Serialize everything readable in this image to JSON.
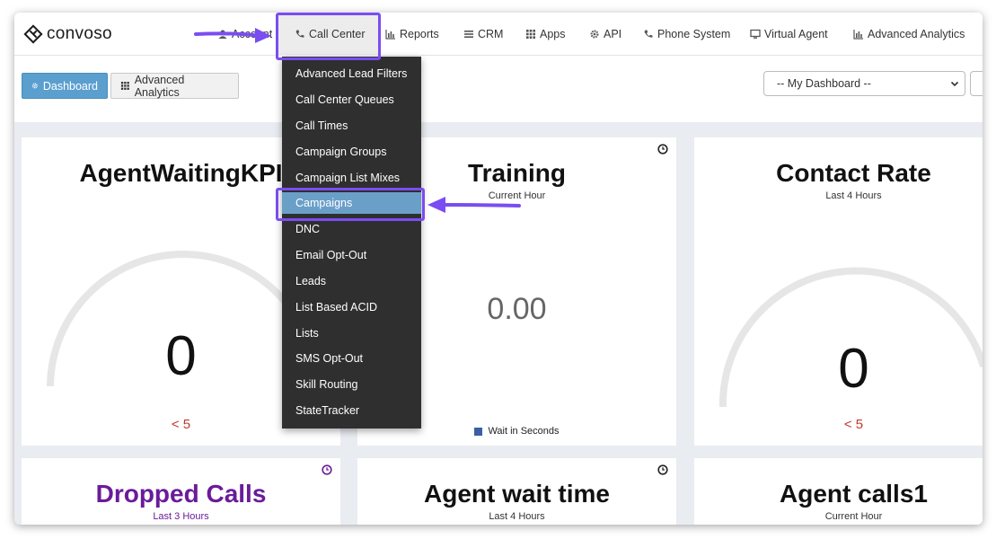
{
  "brand": {
    "logo_text": "convoso"
  },
  "nav": {
    "items": [
      {
        "label": "Account",
        "icon": "user-icon"
      },
      {
        "label": "Call Center",
        "icon": "phone-icon"
      },
      {
        "label": "Reports",
        "icon": "bar-chart-icon"
      },
      {
        "label": "CRM",
        "icon": "list-icon"
      },
      {
        "label": "Apps",
        "icon": "grid-icon"
      },
      {
        "label": "API",
        "icon": "gear-icon"
      },
      {
        "label": "Phone System",
        "icon": "phone-icon"
      },
      {
        "label": "Virtual Agent",
        "icon": "monitor-icon"
      },
      {
        "label": "Advanced Analytics",
        "icon": "bar-chart-icon"
      }
    ],
    "active": "Call Center"
  },
  "toolbar": {
    "dashboard_label": "Dashboard",
    "advanced_analytics_label": "Advanced Analytics",
    "dashboard_select": "-- My Dashboard --"
  },
  "call_center_menu": {
    "items": [
      "Advanced Lead Filters",
      "Call Center Queues",
      "Call Times",
      "Campaign Groups",
      "Campaign List Mixes",
      "Campaigns",
      "DNC",
      "Email Opt-Out",
      "Leads",
      "List Based ACID",
      "Lists",
      "SMS Opt-Out",
      "Skill Routing",
      "StateTracker"
    ],
    "selected": "Campaigns"
  },
  "widgets": {
    "agent_waiting": {
      "title": "AgentWaitingKPI",
      "value": "0",
      "threshold": "< 5"
    },
    "training": {
      "title": "Training",
      "subtitle": "Current Hour",
      "value": "0.00",
      "legend": "Wait in Seconds"
    },
    "contact_rate": {
      "title": "Contact Rate",
      "subtitle": "Last 4 Hours",
      "value": "0",
      "threshold": "< 5"
    },
    "dropped_calls": {
      "title": "Dropped Calls",
      "subtitle": "Last 3 Hours"
    },
    "agent_wait_time": {
      "title": "Agent wait time",
      "subtitle": "Last 4 Hours"
    },
    "agent_calls1": {
      "title": "Agent calls1",
      "subtitle": "Current Hour"
    }
  },
  "colors": {
    "accent_annotation": "#7a4df2",
    "primary_button": "#5b9fcf",
    "menu_bg": "#2f2f2f",
    "menu_selected": "#6a9fc8",
    "threshold_red": "#c0392b",
    "dropped_calls_purple": "#6a1b9a"
  }
}
